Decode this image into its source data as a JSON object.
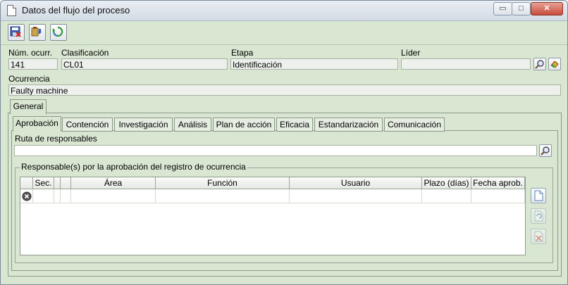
{
  "window": {
    "title": "Datos del flujo del proceso",
    "min_glyph": "▭",
    "max_glyph": "□",
    "close_glyph": "✕"
  },
  "fields": {
    "num_ocurr": {
      "label": "Núm. ocurr.",
      "value": "141"
    },
    "clasificacion": {
      "label": "Clasificación",
      "value": "CL01"
    },
    "etapa": {
      "label": "Etapa",
      "value": "Identificación"
    },
    "lider": {
      "label": "Líder",
      "value": ""
    },
    "ocurrencia": {
      "label": "Ocurrencia",
      "value": "Faulty machine"
    }
  },
  "outer_tab": {
    "label": "General"
  },
  "tabs": [
    {
      "label": "Aprobación"
    },
    {
      "label": "Contención"
    },
    {
      "label": "Investigación"
    },
    {
      "label": "Análisis"
    },
    {
      "label": "Plan de acción"
    },
    {
      "label": "Eficacia"
    },
    {
      "label": "Estandarización"
    },
    {
      "label": "Comunicación"
    }
  ],
  "ruta": {
    "label": "Ruta de responsables",
    "value": ""
  },
  "group": {
    "title": "Responsable(s) por la aprobación del registro de ocurrencia"
  },
  "grid": {
    "columns": [
      "",
      "Sec.",
      "",
      "",
      "Área",
      "Función",
      "Usuario",
      "Plazo (días)",
      "Fecha aprob."
    ]
  },
  "colors": {
    "background": "#d9e6d2",
    "titlebar": "#dce3ea",
    "close": "#c74c3c"
  }
}
